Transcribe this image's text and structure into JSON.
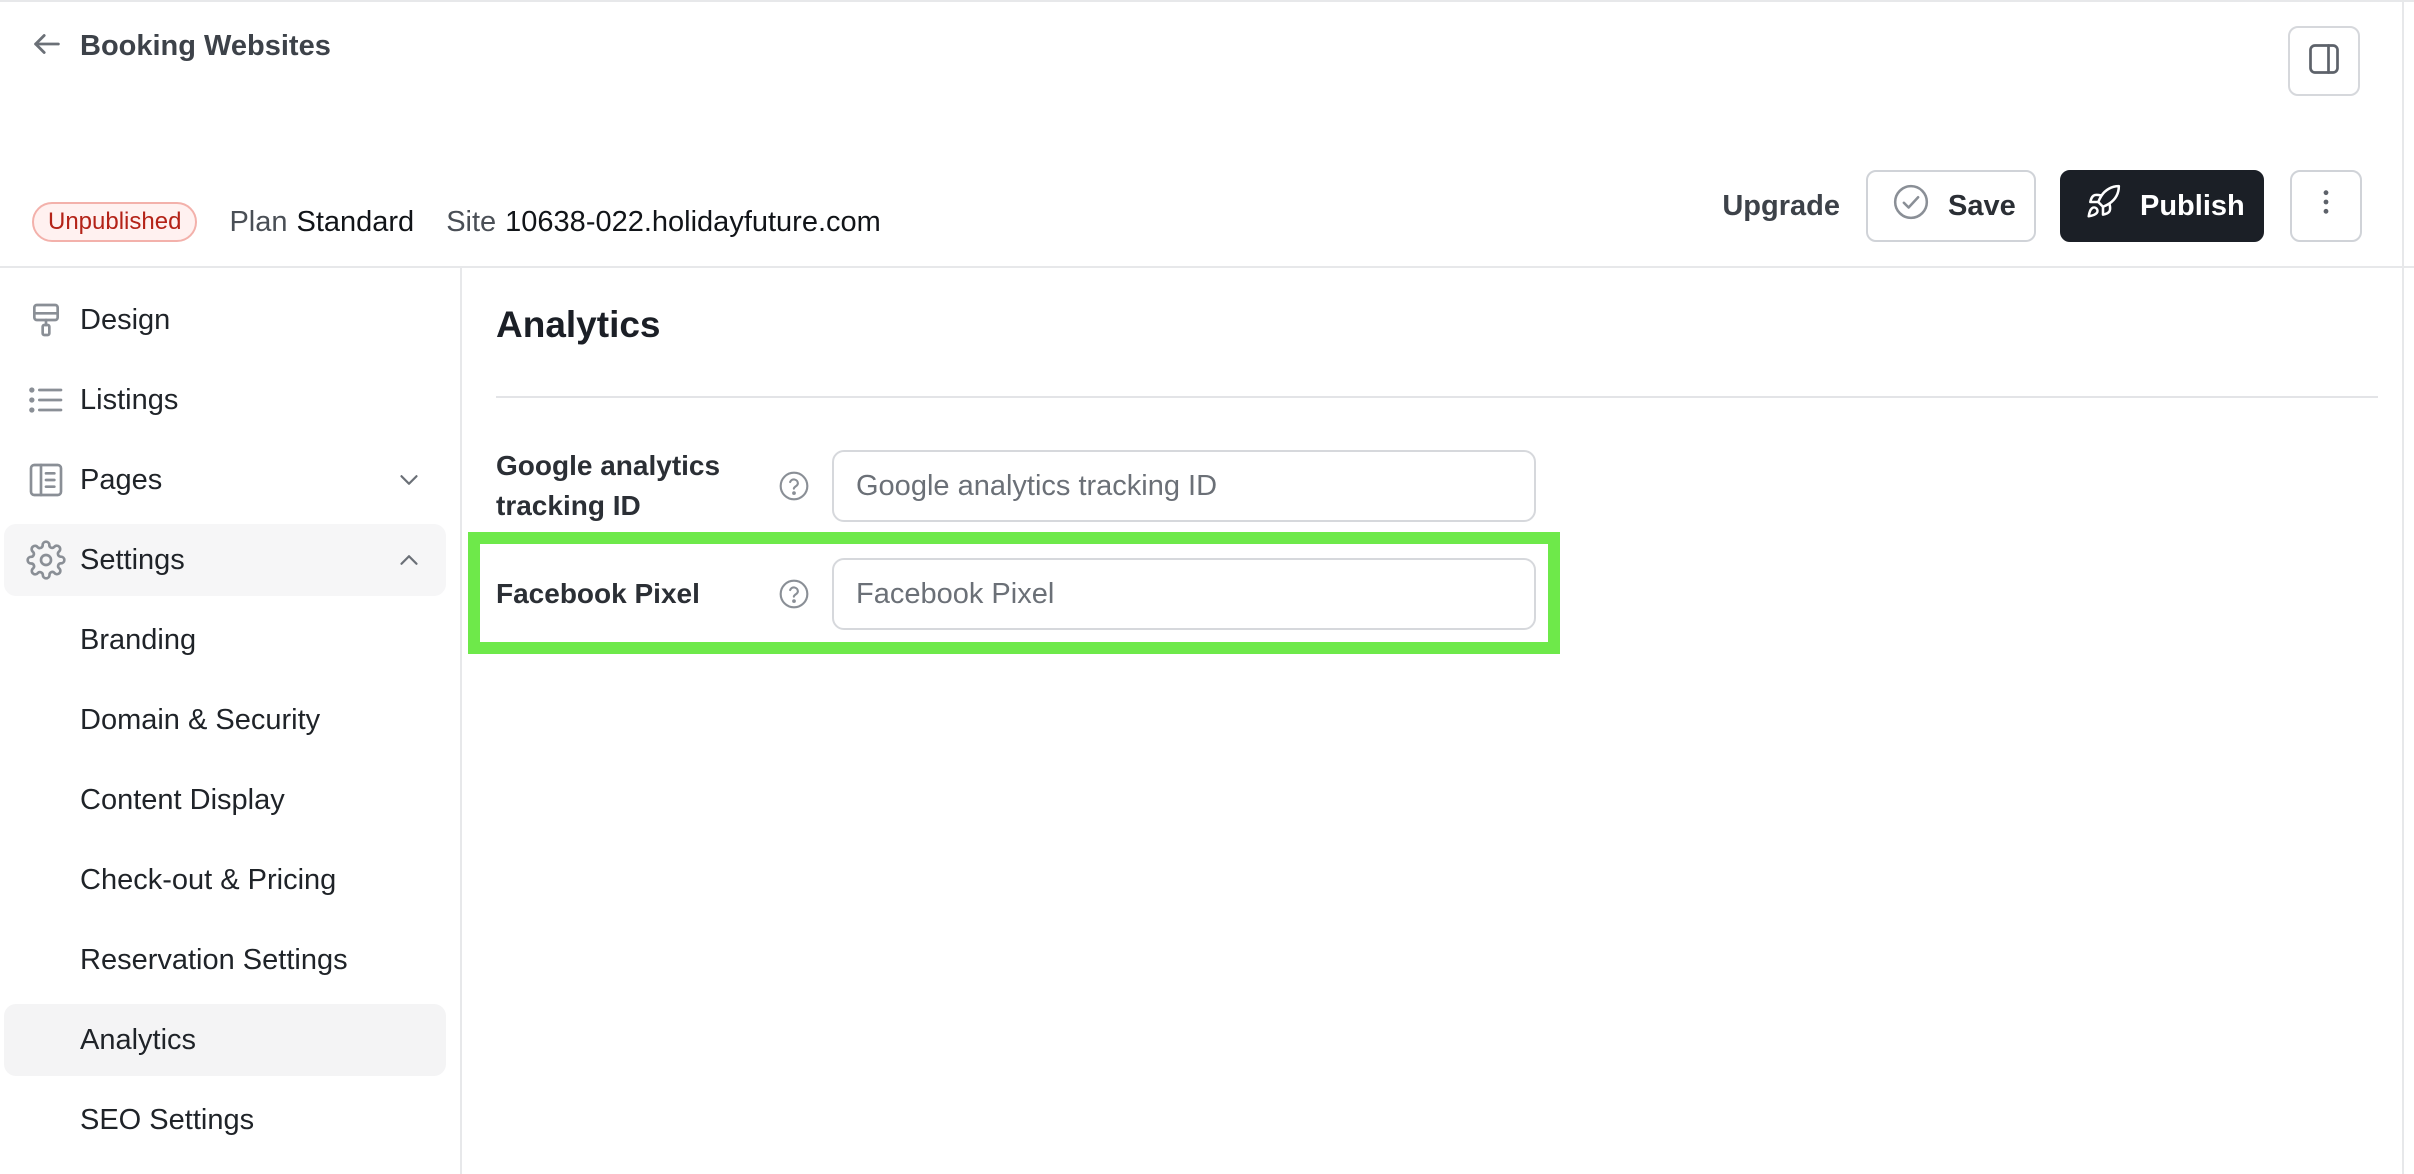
{
  "header": {
    "back_title": "Booking Websites",
    "status_badge": "Unpublished",
    "plan_label": "Plan",
    "plan_value": "Standard",
    "site_label": "Site",
    "site_value": "10638-022.holidayfuture.com"
  },
  "actions": {
    "upgrade_label": "Upgrade",
    "save_label": "Save",
    "publish_label": "Publish"
  },
  "sidebar": {
    "items": [
      {
        "label": "Design",
        "icon": "paint-roller-icon"
      },
      {
        "label": "Listings",
        "icon": "list-icon"
      },
      {
        "label": "Pages",
        "icon": "book-open-icon",
        "chevron": "chevron-down-icon"
      },
      {
        "label": "Settings",
        "icon": "gear-icon",
        "chevron": "chevron-up-icon"
      }
    ],
    "settings_sub_items": [
      {
        "label": "Branding"
      },
      {
        "label": "Domain & Security"
      },
      {
        "label": "Content Display"
      },
      {
        "label": "Check-out & Pricing"
      },
      {
        "label": "Reservation Settings"
      },
      {
        "label": "Analytics",
        "active": true
      },
      {
        "label": "SEO Settings"
      }
    ]
  },
  "main": {
    "title": "Analytics",
    "fields": [
      {
        "label": "Google analytics tracking ID",
        "placeholder": "Google analytics tracking ID",
        "value": ""
      },
      {
        "label": "Facebook Pixel",
        "placeholder": "Facebook Pixel",
        "value": ""
      }
    ]
  },
  "colors": {
    "badge_text": "#b42318",
    "publish_bg": "#1b1f26",
    "highlight": "#6ee94a"
  }
}
